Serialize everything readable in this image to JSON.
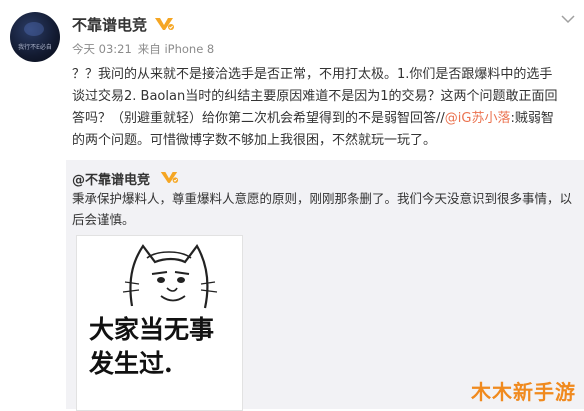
{
  "post": {
    "author": "不靠谱电竞",
    "avatar_text": "我行不E必自",
    "time": "今天 03:21",
    "source": "来自 iPhone 8",
    "text_part1": "？？我问的从来就不是接洽选手是否正常，不用打太极。1.你们是否跟爆料中的选手谈过交易2. Baolan当时的纠结主要原因难道不是因为1的交易？这两个问题敢正面回答吗？（别避重就轻）给你第二次机会希望得到的不是弱智回答//",
    "mention": "@iG苏小落",
    "text_part2": ":贼弱智的两个问题。可惜微博字数不够加上我很困，不然就玩一玩了。"
  },
  "repost": {
    "author": "@不靠谱电竞",
    "text": "秉承保护爆料人，尊重爆料人意愿的原则，刚刚那条删了。我们今天没意识到很多事情，以后会谨慎。",
    "meme_line1": "大家当无事",
    "meme_line2": "发生过."
  },
  "watermark": "木木新手游",
  "icons": {
    "vip": "vip-badge-icon",
    "chevron": "chevron-down-icon"
  },
  "colors": {
    "mention": "#eb7350",
    "repost_bg": "#f2f2f5",
    "watermark": "#f08a1e"
  }
}
